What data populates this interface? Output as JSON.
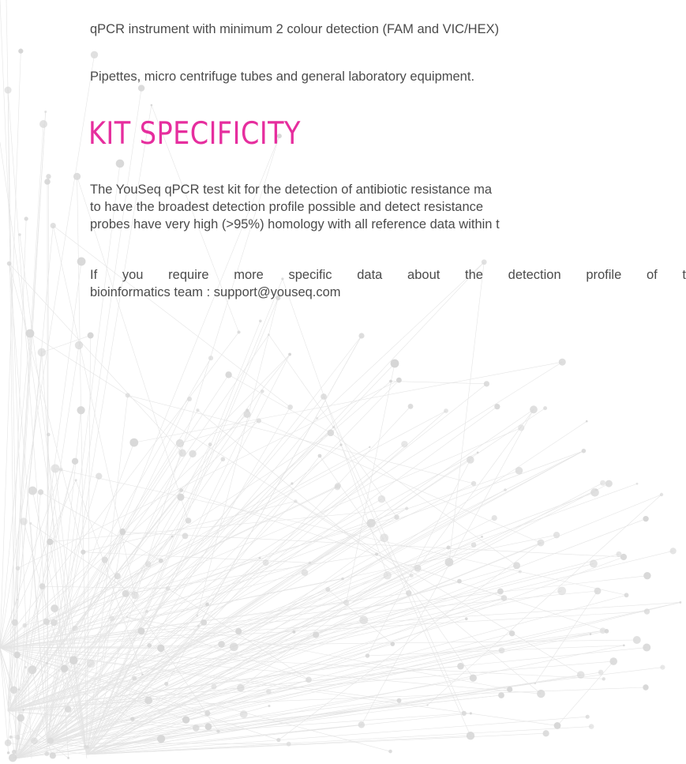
{
  "requirements": {
    "instrument": "qPCR instrument with minimum 2 colour detection (FAM and VIC/HEX)",
    "equipment": "Pipettes, micro centrifuge tubes and general laboratory equipment."
  },
  "section": {
    "heading": "KIT SPECIFICITY",
    "paragraph1": [
      "The YouSeq qPCR test kit for the detection of antibiotic resistance ma",
      "to have the broadest detection profile possible and detect resistance",
      "probes have very high (>95%) homology with all reference data within t"
    ],
    "paragraph2": [
      "If you require more specific data about the detection profile of t",
      "bioinformatics team : support@youseq.com"
    ]
  },
  "colors": {
    "heading": "#e62e9e",
    "body_text": "#4b4b4b",
    "network": "#cfcfcf"
  }
}
